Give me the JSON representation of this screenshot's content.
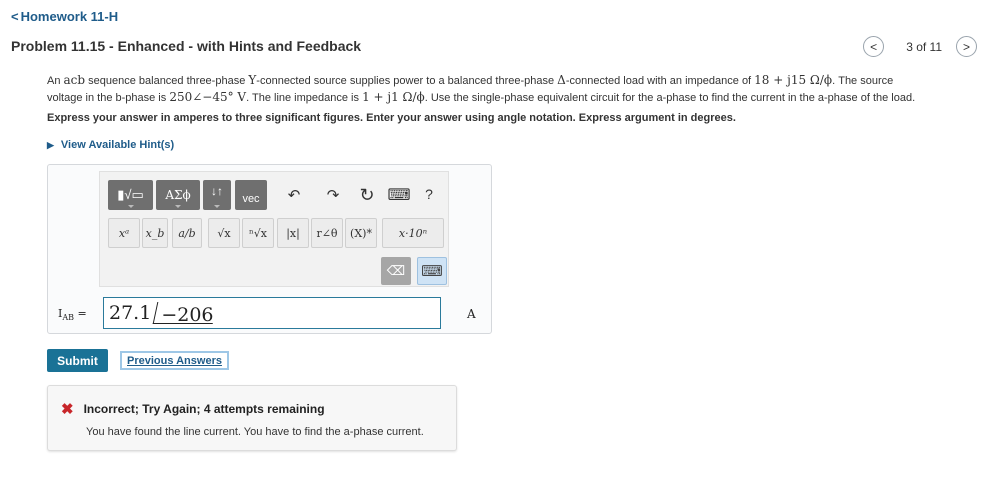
{
  "breadcrumb": {
    "chevron": "<",
    "label": "Homework 11-H"
  },
  "title": "Problem 11.15 - Enhanced - with Hints and Feedback",
  "pager": {
    "prev": "<",
    "count": "3 of 11",
    "next": ">"
  },
  "problem": {
    "l1a": "An ",
    "l1b": "acb",
    "l1c": " sequence balanced three-phase ",
    "l1d": "Y",
    "l1e": "-connected source supplies power to a balanced three-phase ",
    "l1f": "Δ",
    "l1g": "-connected load with an impedance of ",
    "l1h": "18 + j15 Ω/ϕ",
    "l1i": ". The source",
    "l2a": "voltage in the b-phase is ",
    "l2b": "250∠−45° V",
    "l2c": ". The line impedance is ",
    "l2d": "1 + j1 Ω/ϕ",
    "l2e": ". Use the single-phase equivalent circuit for the a-phase to find the current in the a-phase of the load."
  },
  "instructions": "Express your answer in amperes to three significant figures. Enter your answer using angle notation. Express argument in degrees.",
  "hint": "View Available Hint(s)",
  "palette": {
    "templates": "▮√▭",
    "greek": "ΑΣϕ",
    "arrows": "↓↑",
    "vec": "vec",
    "undo": "↶",
    "redo": "↷",
    "reset": "↻",
    "keyboard": "⌨",
    "help": "?",
    "keys": [
      "xᵃ",
      "x_b",
      "a/b",
      "√x",
      "ⁿ√x",
      "|x|",
      "r∠θ",
      "(X)*",
      "x·10ⁿ"
    ],
    "delete": "⌫"
  },
  "answer": {
    "label": "I",
    "label_sub": "AB",
    "label_eq": " =",
    "magnitude": "27.1",
    "angle": "−206",
    "unit": "A"
  },
  "buttons": {
    "submit": "Submit",
    "previous": "Previous Answers"
  },
  "feedback": {
    "icon": "✖",
    "title": "Incorrect; Try Again; 4 attempts remaining",
    "message": "You have found the line current. You have to find the a-phase current."
  }
}
